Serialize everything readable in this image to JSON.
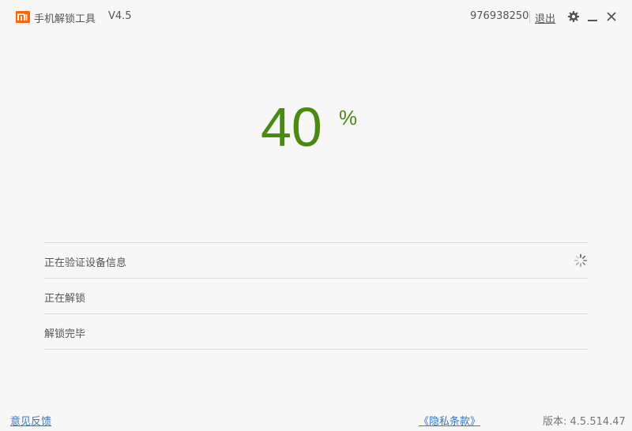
{
  "titlebar": {
    "logo_icon": "mi-logo-icon",
    "app_title": "手机解锁工具",
    "version": "V4.5",
    "account_id": "976938250",
    "logout_label": "退出",
    "settings_icon": "gear-icon",
    "minimize_icon": "minimize-icon",
    "close_icon": "close-icon",
    "brand_color": "#ff6700"
  },
  "progress": {
    "value": "40",
    "unit": "%",
    "color": "#4a8a10"
  },
  "steps": [
    {
      "label": "正在验证设备信息",
      "status": "in-progress",
      "icon": "loading-spinner-icon"
    },
    {
      "label": "正在解锁",
      "status": "pending"
    },
    {
      "label": "解锁完毕",
      "status": "pending"
    }
  ],
  "footer": {
    "feedback_label": "意见反馈",
    "privacy_label": "《隐私条款》",
    "build_version": "版本: 4.5.514.47",
    "link_color": "#3a78c2"
  }
}
